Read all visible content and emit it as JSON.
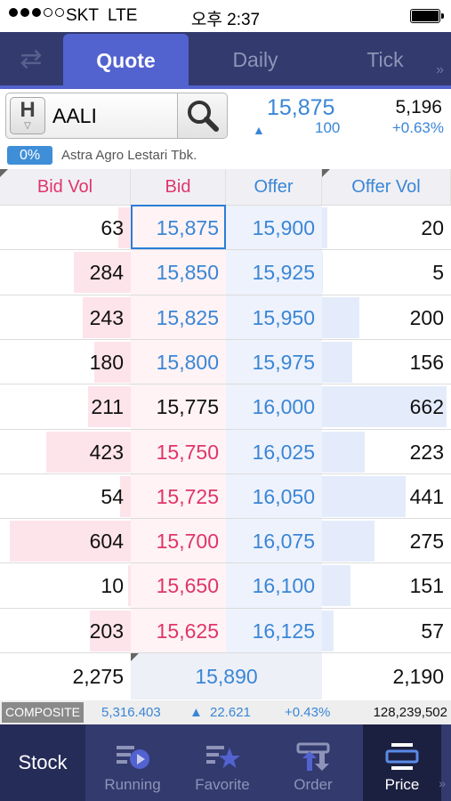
{
  "status_bar": {
    "carrier": "SKT",
    "network": "LTE",
    "time": "오후 2:37"
  },
  "tabs": [
    {
      "label": "Quote",
      "active": true
    },
    {
      "label": "Daily"
    },
    {
      "label": "Tick"
    }
  ],
  "stock": {
    "badge": "H",
    "code": "AALI",
    "name": "Astra Agro Lestari Tbk.",
    "pct_badge": "0%",
    "last_price": "15,875",
    "last_qty": "100",
    "volume": "5,196",
    "change_pct": "+0.63%"
  },
  "orderbook": {
    "headers": {
      "bid_vol": "Bid Vol",
      "bid": "Bid",
      "offer": "Offer",
      "offer_vol": "Offer Vol"
    },
    "rows": [
      {
        "bid_vol": "63",
        "bid": "15,875",
        "offer": "15,900",
        "offer_vol": "20",
        "bid_color": "blue",
        "bid_bar": 0.1,
        "offer_bar": 0.04
      },
      {
        "bid_vol": "284",
        "bid": "15,850",
        "offer": "15,925",
        "offer_vol": "5",
        "bid_color": "blue",
        "bid_bar": 0.47,
        "offer_bar": 0.01
      },
      {
        "bid_vol": "243",
        "bid": "15,825",
        "offer": "15,950",
        "offer_vol": "200",
        "bid_color": "blue",
        "bid_bar": 0.4,
        "offer_bar": 0.3
      },
      {
        "bid_vol": "180",
        "bid": "15,800",
        "offer": "15,975",
        "offer_vol": "156",
        "bid_color": "blue",
        "bid_bar": 0.3,
        "offer_bar": 0.24
      },
      {
        "bid_vol": "211",
        "bid": "15,775",
        "offer": "16,000",
        "offer_vol": "662",
        "bid_color": "black",
        "bid_bar": 0.35,
        "offer_bar": 1.0
      },
      {
        "bid_vol": "423",
        "bid": "15,750",
        "offer": "16,025",
        "offer_vol": "223",
        "bid_color": "red",
        "bid_bar": 0.7,
        "offer_bar": 0.34
      },
      {
        "bid_vol": "54",
        "bid": "15,725",
        "offer": "16,050",
        "offer_vol": "441",
        "bid_color": "red",
        "bid_bar": 0.09,
        "offer_bar": 0.67
      },
      {
        "bid_vol": "604",
        "bid": "15,700",
        "offer": "16,075",
        "offer_vol": "275",
        "bid_color": "red",
        "bid_bar": 1.0,
        "offer_bar": 0.42
      },
      {
        "bid_vol": "10",
        "bid": "15,650",
        "offer": "16,100",
        "offer_vol": "151",
        "bid_color": "red",
        "bid_bar": 0.02,
        "offer_bar": 0.23
      },
      {
        "bid_vol": "203",
        "bid": "15,625",
        "offer": "16,125",
        "offer_vol": "57",
        "bid_color": "red",
        "bid_bar": 0.34,
        "offer_bar": 0.09
      }
    ],
    "total_bid": "2,275",
    "mid_price": "15,890",
    "total_offer": "2,190"
  },
  "composite": {
    "label": "COMPOSITE",
    "index": "5,316.403",
    "change": "22.621",
    "change_pct": "+0.43%",
    "volume": "128,239,502"
  },
  "nav": {
    "stock": "Stock",
    "running": "Running",
    "favorite": "Favorite",
    "order": "Order",
    "price": "Price"
  },
  "colors": {
    "red": "#e0356a",
    "blue": "#3a86d6",
    "black": "#111111",
    "accent": "#5262cf",
    "nav": "#323a6e"
  }
}
